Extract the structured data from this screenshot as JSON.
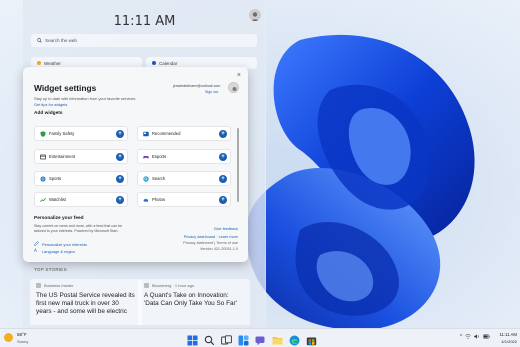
{
  "board": {
    "clock": "11:11 AM",
    "search_placeholder": "Search the web",
    "cards": {
      "weather_label": "Weather",
      "calendar_label": "Calendar"
    },
    "top_stories_label": "TOP STORIES",
    "news": [
      {
        "source": "Business Insider",
        "title": "The US Postal Service revealed its first new mail truck in over 30 years - and some will be electric"
      },
      {
        "source": "Bloomberg · 1 hour ago",
        "title": "A Quant's Take on Innovation: 'Data Can Only Take You So Far'"
      }
    ]
  },
  "dialog": {
    "close": "×",
    "title": "Widget settings",
    "subtitle": "Stay up to date with information from your favorite services.",
    "tips_link": "Get tips for widgets",
    "account_email": "jenwiedebharm@outlook.com",
    "sign_out": "Sign out",
    "add_widgets_heading": "Add widgets",
    "widgets": [
      {
        "label": "Family Safety",
        "icon": "family-safety-icon",
        "color": "#2e9a47"
      },
      {
        "label": "Recommended",
        "icon": "recommended-icon",
        "color": "#1a5fb4"
      },
      {
        "label": "Entertainment",
        "icon": "entertainment-icon",
        "color": "#333333"
      },
      {
        "label": "Esports",
        "icon": "esports-icon",
        "color": "#7a3fb4"
      },
      {
        "label": "Sports",
        "icon": "sports-icon",
        "color": "#2677c9"
      },
      {
        "label": "Search",
        "icon": "search-icon",
        "color": "#2aa0d6"
      },
      {
        "label": "Watchlist",
        "icon": "watchlist-icon",
        "color": "#2e9a47"
      },
      {
        "label": "Photos",
        "icon": "photos-icon",
        "color": "#1a6fd8"
      }
    ],
    "add_symbol": "+",
    "personalize_heading": "Personalize your feed",
    "personalize_desc_1": "Stay current on news and more, with a feed that can be",
    "personalize_desc_2": "tailored to your interests. Powered by Microsoft Start.",
    "personalize_interests": "Personalize your interests",
    "language_region": "Language & region",
    "give_feedback": "Give feedback",
    "privacy_links": "Privacy dashboard · Learn more",
    "privacy_statement": "Privacy statement | Terms of use",
    "version": "Version 421.20031.1.0"
  },
  "taskbar": {
    "temperature": "58°F",
    "condition": "Sunny",
    "time": "11:11 AM",
    "date": "4/1/2022"
  },
  "colors": {
    "accent": "#1a5fb4",
    "wallpaper_bg": "#e3ecf6",
    "bloom": "#1346d6"
  }
}
